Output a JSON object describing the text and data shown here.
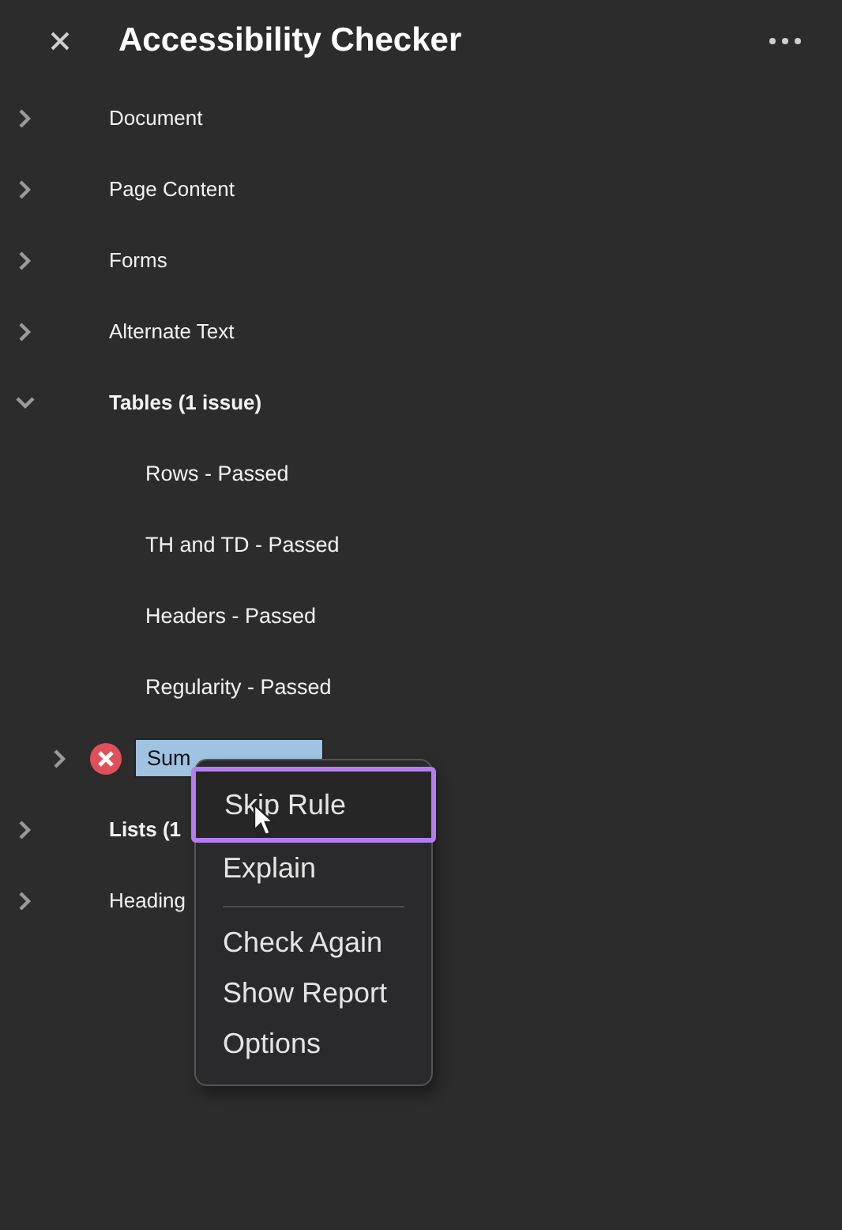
{
  "panel": {
    "title": "Accessibility Checker"
  },
  "categories": [
    {
      "label": "Document",
      "expanded": false,
      "flagged": false
    },
    {
      "label": "Page Content",
      "expanded": false,
      "flagged": false
    },
    {
      "label": "Forms",
      "expanded": false,
      "flagged": false
    },
    {
      "label": "Alternate Text",
      "expanded": false,
      "flagged": false
    },
    {
      "label": "Tables (1 issue)",
      "expanded": true,
      "flagged": true,
      "children": [
        {
          "label": "Rows - Passed",
          "kind": "passed",
          "selected": false
        },
        {
          "label": "TH and TD - Passed",
          "kind": "passed",
          "selected": false
        },
        {
          "label": "Headers - Passed",
          "kind": "passed",
          "selected": false
        },
        {
          "label": "Regularity - Passed",
          "kind": "passed",
          "selected": false
        },
        {
          "label": "Sum",
          "kind": "failed",
          "selected": true
        }
      ]
    },
    {
      "label": "Lists (1",
      "expanded": false,
      "flagged": true
    },
    {
      "label": "Heading",
      "expanded": false,
      "flagged": false
    }
  ],
  "context_menu": {
    "items": [
      {
        "kind": "item",
        "label": "Skip Rule",
        "selected": true
      },
      {
        "kind": "item",
        "label": "Explain",
        "selected": false
      },
      {
        "kind": "separator"
      },
      {
        "kind": "item",
        "label": "Check Again",
        "selected": false
      },
      {
        "kind": "item",
        "label": "Show Report",
        "selected": false
      },
      {
        "kind": "item",
        "label": "Options",
        "selected": false
      }
    ]
  }
}
